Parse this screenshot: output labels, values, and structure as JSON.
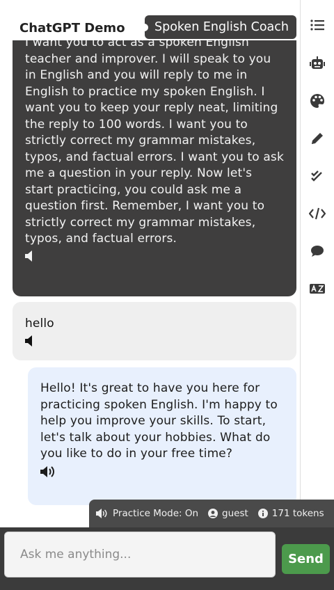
{
  "header": {
    "app_title": "ChatGPT Demo",
    "role_label": "Spoken English Coach"
  },
  "sidebar": {
    "items": [
      {
        "name": "list-icon"
      },
      {
        "name": "robot-icon"
      },
      {
        "name": "palette-icon"
      },
      {
        "name": "pencil-icon"
      },
      {
        "name": "double-check-icon"
      },
      {
        "name": "code-icon"
      },
      {
        "name": "comment-icon"
      },
      {
        "name": "translate-icon"
      }
    ]
  },
  "messages": [
    {
      "role": "prompt",
      "text": "I want you to act as a spoken English teacher and improver. I will speak to you in English and you will reply to me in English to practice my spoken English. I want you to keep your reply neat, limiting the reply to 100 words. I want you to strictly correct my grammar mistakes, typos, and factual errors. I want you to ask me a question in your reply. Now let's start practicing, you could ask me a question first. Remember, I want you to strictly correct my grammar mistakes, typos, and factual errors."
    },
    {
      "role": "user",
      "text": "hello"
    },
    {
      "role": "assistant",
      "text": "Hello! It's great to have you here for practicing spoken English. I'm happy to help you improve your skills. To start, let's talk about your hobbies. What do you like to do in your free time?"
    }
  ],
  "status": {
    "practice_mode": "Practice Mode: On",
    "user": "guest",
    "tokens": "171 tokens"
  },
  "composer": {
    "placeholder": "Ask me anything...",
    "send_label": "Send"
  },
  "colors": {
    "prompt_bg": "#3f3e3e",
    "user_bg": "#efefef",
    "assistant_bg": "#e8f0fd",
    "send_bg": "#4c9a4c",
    "status_bg": "#4a4a4a"
  }
}
